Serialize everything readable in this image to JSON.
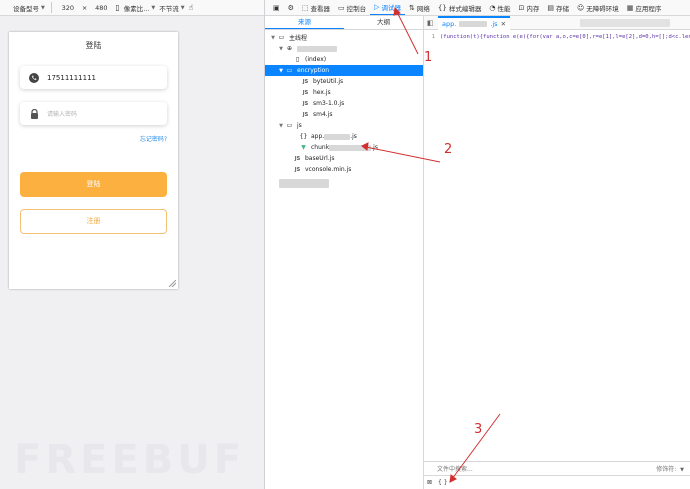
{
  "rdm_toolbar": {
    "device": "设备型号",
    "width": "320",
    "height": "480",
    "dpr": "像素比...",
    "throttle": "不节流"
  },
  "login_page": {
    "title": "登陆",
    "phone_value": "17511111111",
    "password_placeholder": "请输入密码",
    "forgot_link": "忘记密码?",
    "login_button": "登陆",
    "register_button": "注册",
    "accent_color": "#fbb040"
  },
  "watermark": "FREEBUF",
  "devtools": {
    "tabs": [
      {
        "label": "查看器",
        "icon": "inspector-icon"
      },
      {
        "label": "控制台",
        "icon": "console-icon"
      },
      {
        "label": "调试器",
        "icon": "debugger-icon"
      },
      {
        "label": "网络",
        "icon": "network-icon"
      },
      {
        "label": "样式编辑器",
        "icon": "style-editor-icon"
      },
      {
        "label": "性能",
        "icon": "performance-icon"
      },
      {
        "label": "内存",
        "icon": "memory-icon"
      },
      {
        "label": "存储",
        "icon": "storage-icon"
      },
      {
        "label": "无障碍环境",
        "icon": "accessibility-icon"
      },
      {
        "label": "应用程序",
        "icon": "application-icon"
      }
    ],
    "sources_tabs": {
      "sources": "来源",
      "outline": "大纲"
    },
    "tree": {
      "main_thread": "主线程",
      "index": "(index)",
      "encryption": "encryption",
      "files": [
        "byteUtil.js",
        "hex.js",
        "sm3-1.0.js",
        "sm4.js"
      ],
      "js_folder": "js",
      "app_prefix": "app.",
      "app_suffix": ".js",
      "chunk_prefix": "chunk",
      "chunk_suffix": ".js",
      "base_url": "baseUrl.js",
      "vconsole": "vconsole.min.js",
      "js_badge": "JS"
    },
    "editor": {
      "tab_prefix": "app.",
      "tab_suffix": ".js",
      "line_number": "1",
      "code": "(function(t){function e(e){for(var a,o,c=e[0],r=e[1],l=e[2],d=0,h=[];d<c.length"
    },
    "search": {
      "placeholder": "文件中搜索...",
      "modifiers": "修饰符:"
    },
    "status": {
      "pretty_print": "{ }"
    }
  },
  "annotations": {
    "one": "1",
    "two": "2",
    "three": "3",
    "color": "#d32f2f"
  }
}
